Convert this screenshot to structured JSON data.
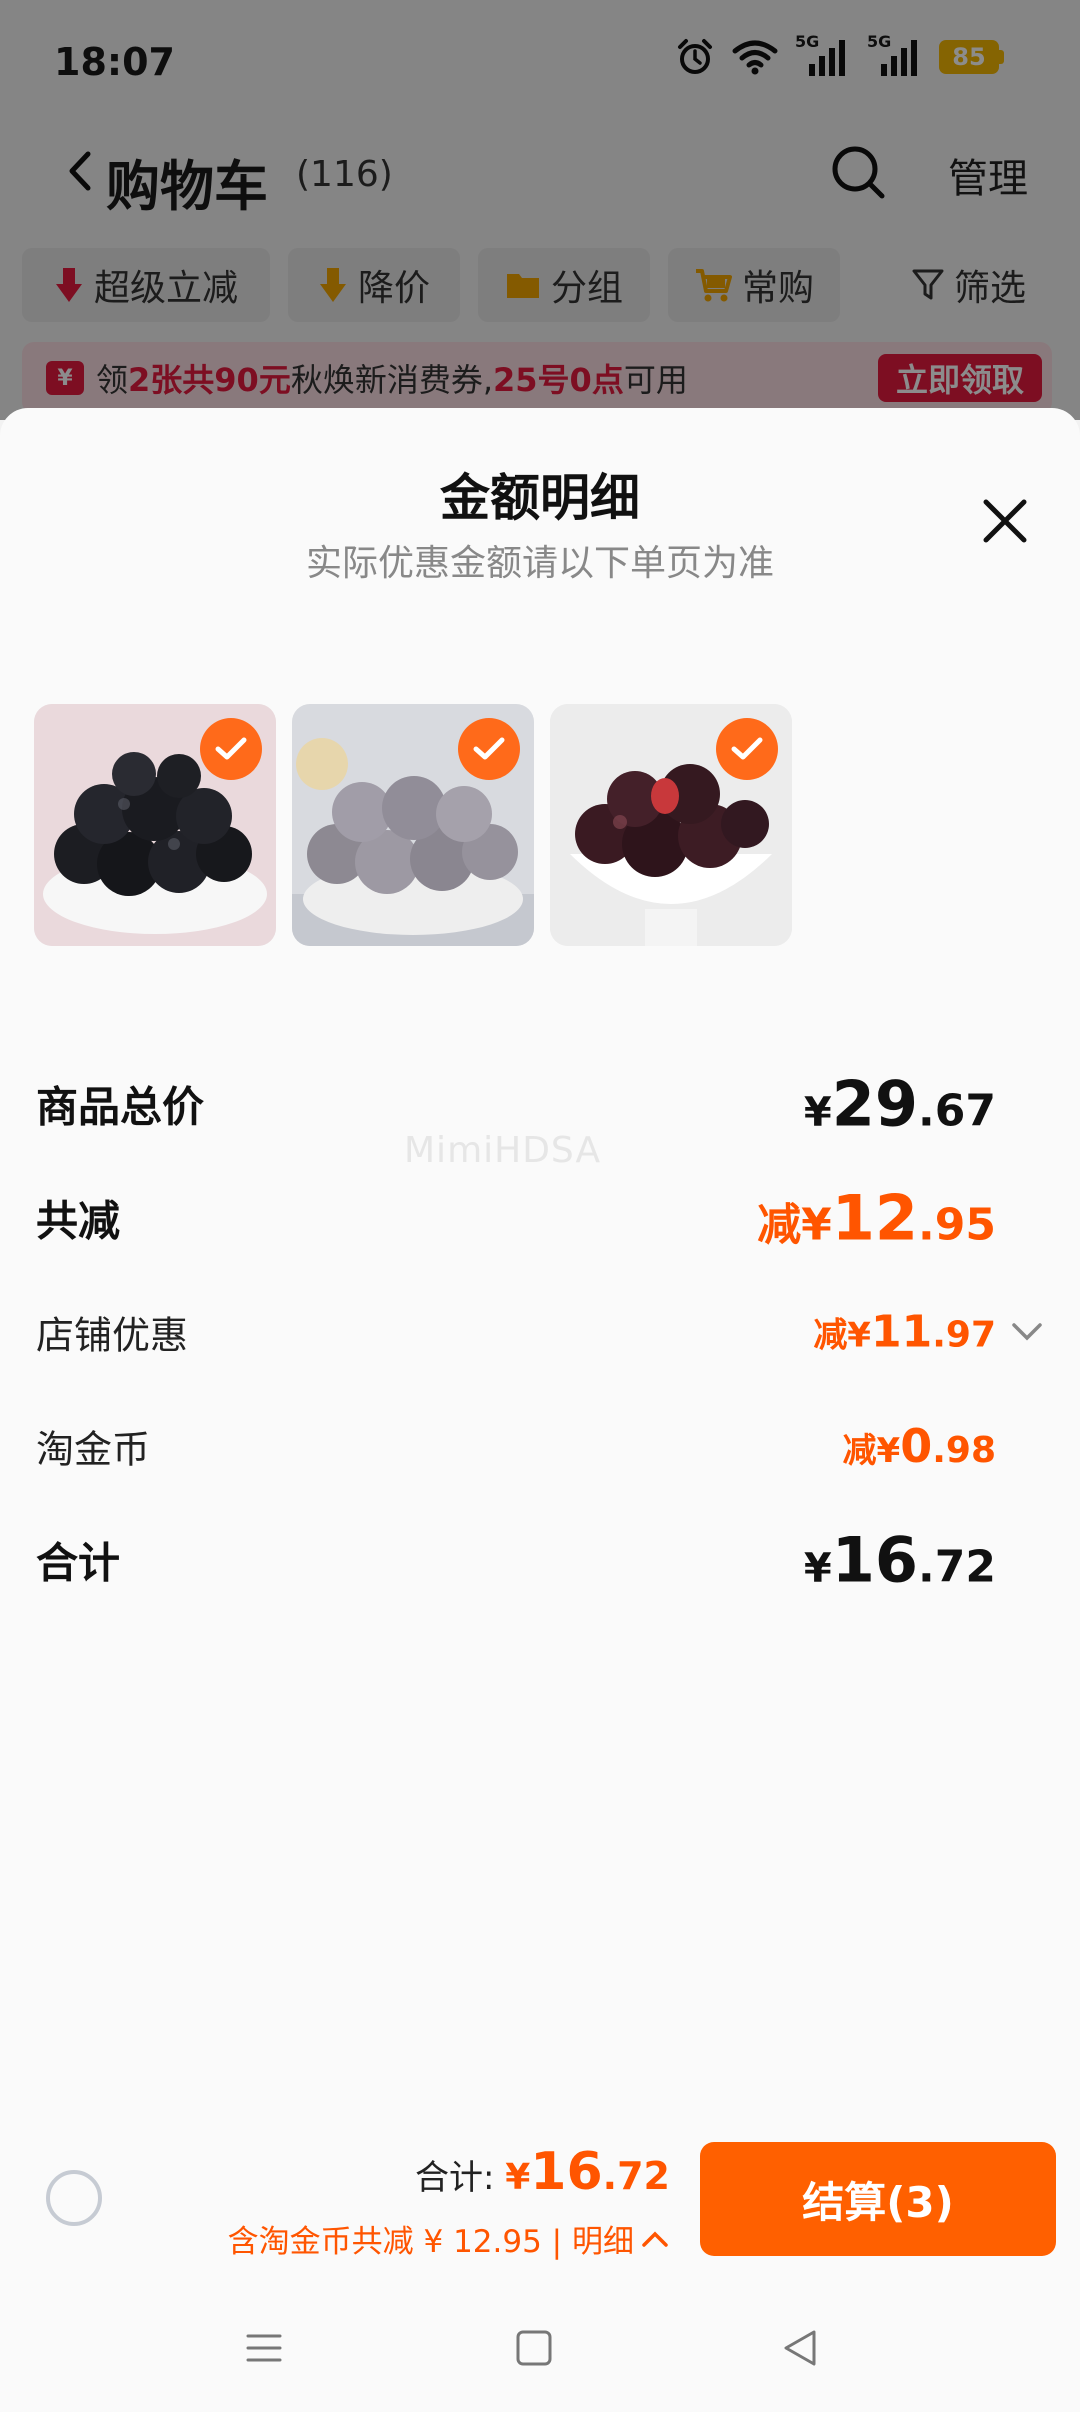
{
  "status_bar": {
    "time": "18:07",
    "network_1": "5G",
    "network_2": "5G",
    "battery": "85"
  },
  "nav": {
    "title": "购物车",
    "count": "(116)",
    "manage_label": "管理",
    "icons": [
      "back-icon",
      "search-icon"
    ]
  },
  "filters": {
    "items": [
      {
        "label": "超级立减",
        "icon": "red-down-arrow-icon"
      },
      {
        "label": "降价",
        "icon": "price-drop-icon"
      },
      {
        "label": "分组",
        "icon": "folder-icon"
      },
      {
        "label": "常购",
        "icon": "cart-icon"
      }
    ],
    "filter_label": "筛选"
  },
  "coupon": {
    "icon_text": "¥",
    "prefix": "领",
    "highlight_1": "2张共90元",
    "middle": "秋焕新消费券,",
    "highlight_2": "25号0点",
    "suffix": "可用",
    "button": "立即领取"
  },
  "sheet": {
    "title": "金额明细",
    "subtitle": "实际优惠金额请以下单页为准",
    "products": [
      {
        "name": "dark-prunes",
        "selected": true
      },
      {
        "name": "frosted-plums",
        "selected": true
      },
      {
        "name": "red-plums",
        "selected": true
      }
    ],
    "rows": {
      "total_price": {
        "label": "商品总价",
        "currency": "¥",
        "integer": "29",
        "decimal": ".67"
      },
      "total_discount": {
        "label": "共减",
        "prefix": "减¥",
        "integer": "12",
        "decimal": ".95"
      },
      "shop_discount": {
        "label": "店铺优惠",
        "prefix": "减¥",
        "integer": "11",
        "decimal": ".97"
      },
      "coins": {
        "label": "淘金币",
        "prefix": "减¥",
        "integer": "0",
        "decimal": ".98"
      },
      "sum": {
        "label": "合计",
        "currency": "¥",
        "integer": "16",
        "decimal": ".72"
      }
    },
    "watermark": "MimiHDSA"
  },
  "checkout": {
    "total_label": "合计:",
    "currency": "¥",
    "integer": "16",
    "decimal": ".72",
    "detail_text": "含淘金币共减 ¥ 12.95 | 明细",
    "button": "结算(3)"
  },
  "colors": {
    "accent": "#ff6000",
    "discount": "#ff5500",
    "coupon_red": "#e31b3f"
  }
}
